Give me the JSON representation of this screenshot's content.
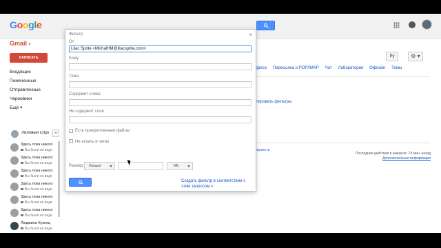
{
  "topbar": {
    "logo": [
      "G",
      "o",
      "o",
      "g",
      "l",
      "e"
    ]
  },
  "sidebar": {
    "gmail_label": "Gmail",
    "compose_label": "НАПИСАТЬ",
    "items": [
      {
        "label": "Входящие"
      },
      {
        "label": "Помеченные"
      },
      {
        "label": "Отправленные"
      },
      {
        "label": "Черновики"
      },
      {
        "label": "Ещё ▾"
      }
    ]
  },
  "chat": {
    "self_name": "Лиловый Спра",
    "plus": "+",
    "contacts": [
      {
        "name": "Здесь пока никого",
        "status": "Вы были на виде"
      },
      {
        "name": "Здесь пока никого",
        "status": "Вы были на виде"
      },
      {
        "name": "Здесь пока никого",
        "status": "Вы были на виде"
      },
      {
        "name": "Здесь пока никого",
        "status": "Вы были на виде"
      },
      {
        "name": "Здесь пока никого",
        "status": "Вы были на виде"
      },
      {
        "name": "Здесь пока никого",
        "status": "Вы были на виде"
      },
      {
        "name": "Людмила Кузнец",
        "status": "Вы были на виде"
      }
    ]
  },
  "settings_bg": {
    "lang": "Ру",
    "gear": "⚙ ▾",
    "tabs": [
      "и адреса",
      "Пересылка и POP/IMAP",
      "Чат",
      "Лаборатория",
      "Офлайн",
      "Темы"
    ],
    "link1": "портировать фильтры",
    "fragment": "ы",
    "link2": "ьдальность",
    "activity_text": "Последние действия в аккаунте: 23 мин. назад",
    "activity_link": "Дополнительная информация"
  },
  "filter_dialog": {
    "title": "Фильтр",
    "close": "×",
    "from_label": "От",
    "from_value": "Lilac Sprite <MichalHM@lilacsprite.com>",
    "to_label": "Кому",
    "subject_label": "Тема",
    "has_words_label": "Содержит слова",
    "not_words_label": "Не содержит слов",
    "has_attach_label": "Есть прикрепленные файлы",
    "no_chats_label": "Не искать в чатах",
    "size_label": "Размер",
    "size_op": "больше",
    "size_unit": "МБ",
    "create_link": "Создать фильтр в соответствии с этим запросом »"
  }
}
